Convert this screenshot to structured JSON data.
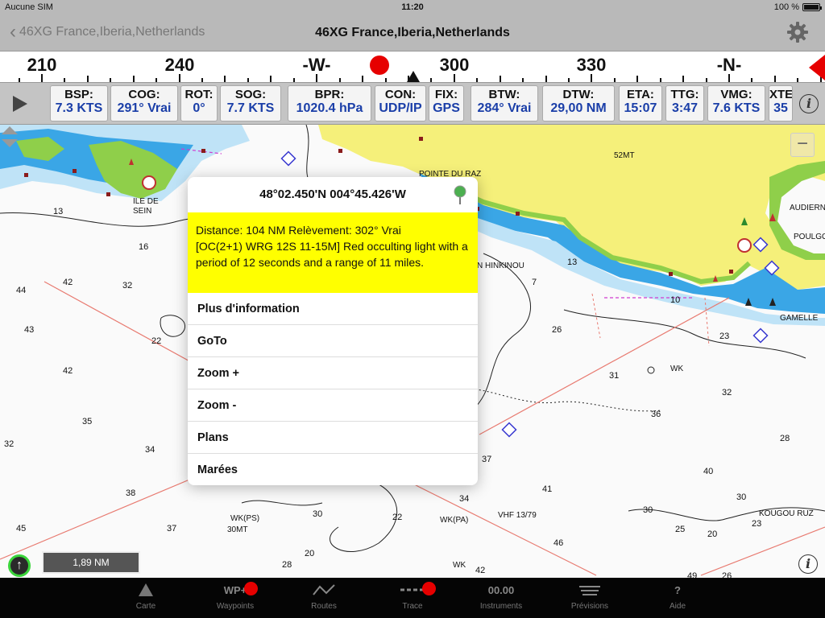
{
  "status": {
    "carrier": "Aucune SIM",
    "time": "11:20",
    "battery": "100 %"
  },
  "nav": {
    "back_label": "46XG France,Iberia,Netherlands",
    "title": "46XG France,Iberia,Netherlands",
    "settings_icon": "gear-icon"
  },
  "compass": {
    "labels": [
      "210",
      "240",
      "-W-",
      "300",
      "330",
      "-N-"
    ],
    "target_color": "#e60000"
  },
  "instruments": [
    {
      "key": "BSP:",
      "value": "7.3 KTS"
    },
    {
      "key": "COG:",
      "value": "291° Vrai"
    },
    {
      "key": "ROT:",
      "value": "0°"
    },
    {
      "key": "SOG:",
      "value": "7.7 KTS"
    },
    {
      "key": "BPR:",
      "value": "1020.4 hPa"
    },
    {
      "key": "CON:",
      "value": "UDP/IP"
    },
    {
      "key": "FIX:",
      "value": "GPS"
    },
    {
      "key": "BTW:",
      "value": "284° Vrai"
    },
    {
      "key": "DTW:",
      "value": "29,00 NM"
    },
    {
      "key": "ETA:",
      "value": "15:07"
    },
    {
      "key": "TTG:",
      "value": "3:47"
    },
    {
      "key": "VMG:",
      "value": "7.6 KTS"
    },
    {
      "key": "XTE",
      "value": "35"
    }
  ],
  "map": {
    "scale": "1,89 NM",
    "zoom_out_label": "−",
    "places": {
      "ile_de_sein": "ILE DE SEIN",
      "pointe_du_raz": "POINTE DU RAZ",
      "hinkinou": "N HINKINOU",
      "audierne": "AUDIERN",
      "poulgoazec": "POULGO",
      "gamelle": "GAMELLE",
      "kougou": "KOUGOU RUZ",
      "vhf": "VHF 13/79",
      "wk1": "WK",
      "wk2": "WK(PA)",
      "wk3": "WK(PS)",
      "wk4": "WK",
      "mt52": "52MT",
      "mt30": "30MT"
    },
    "depths": [
      "43",
      "13",
      "16",
      "44",
      "42",
      "32",
      "43",
      "22",
      "42",
      "35",
      "34",
      "32",
      "38",
      "37",
      "45",
      "30",
      "20",
      "28",
      "22",
      "34",
      "37",
      "41",
      "31",
      "26",
      "23",
      "32",
      "36",
      "28",
      "40",
      "30",
      "30",
      "25",
      "20",
      "23",
      "46",
      "49",
      "26",
      "42",
      "10",
      "7",
      "13"
    ]
  },
  "popup": {
    "coord": "48°02.450'N 004°45.426'W",
    "distance_line": "Distance: 104 NM  Relèvement: 302° Vrai",
    "light_description": "[OC(2+1) WRG 12S 11-15M] Red occulting light with a period of 12 seconds and a range of 11 miles.",
    "menu": [
      "Plus d'information",
      "GoTo",
      "Zoom +",
      "Zoom -",
      "Plans",
      "Marées"
    ]
  },
  "tabs": [
    {
      "label": "Carte",
      "icon_text": ""
    },
    {
      "label": "Waypoints",
      "icon_text": "WP+"
    },
    {
      "label": "Routes",
      "icon_text": ""
    },
    {
      "label": "Trace",
      "icon_text": ""
    },
    {
      "label": "Instruments",
      "icon_text": "00.00"
    },
    {
      "label": "Prévisions",
      "icon_text": ""
    },
    {
      "label": "Aide",
      "icon_text": "?"
    }
  ],
  "colors": {
    "land": "#f5f07a",
    "shallow": "#3aa6e6",
    "mid": "#bfe3f7",
    "drying": "#8fcf4a",
    "accent": "#1a3ea8",
    "alert": "#e60000"
  }
}
